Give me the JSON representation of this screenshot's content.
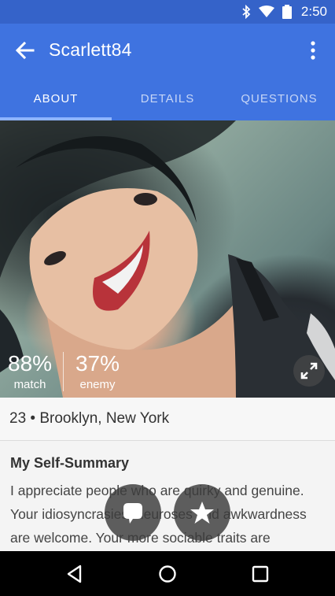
{
  "status_bar": {
    "time": "2:50",
    "icons": [
      "bluetooth-icon",
      "wifi-icon",
      "battery-icon"
    ]
  },
  "app_bar": {
    "title": "Scarlett84",
    "back_icon": "arrow-left-icon",
    "menu_icon": "more-vert-icon"
  },
  "tabs": [
    {
      "label": "ABOUT",
      "active": true
    },
    {
      "label": "DETAILS",
      "active": false
    },
    {
      "label": "QUESTIONS",
      "active": false
    }
  ],
  "photo": {
    "match": {
      "percent": "88%",
      "label": "match"
    },
    "enemy": {
      "percent": "37%",
      "label": "enemy"
    },
    "expand_icon": "fullscreen-icon"
  },
  "profile": {
    "location_line": "23 • Brooklyn, New York"
  },
  "self_summary": {
    "heading": "My Self-Summary",
    "text": "I appreciate people who are quirky and genuine. Your idiosyncrasies, neuroses and awkwardness are welcome. Your more sociable traits are"
  },
  "actions": {
    "message_icon": "chat-bubble-icon",
    "favorite_icon": "star-icon"
  },
  "nav_bar": {
    "icons": [
      "back-triangle-icon",
      "home-circle-icon",
      "recents-square-icon"
    ]
  },
  "colors": {
    "primary": "#3f73e0",
    "status_bar": "#3563c9",
    "tab_indicator": "#8fb4ff"
  }
}
